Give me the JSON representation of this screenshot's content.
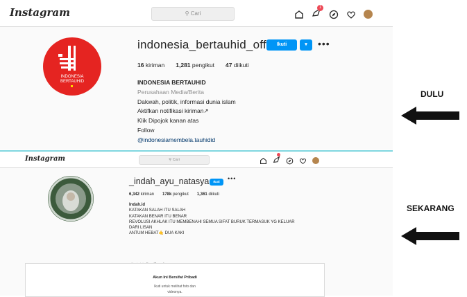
{
  "brand": "Instagram",
  "search_placeholder": "Cari",
  "labels": {
    "old": "DULU",
    "new": "SEKARANG"
  },
  "old_profile": {
    "username": "indonesia_bertauhid_official",
    "follow_label": "Ikuti",
    "stats": {
      "posts": "16",
      "posts_label": "kiriman",
      "followers": "1,281",
      "followers_label": "pengikut",
      "following": "47",
      "following_label": "diikuti"
    },
    "display_name": "INDONESIA BERTAUHID",
    "category": "Perusahaan Media/Berita",
    "bio_lines": [
      "Dakwah, politik, informasi dunia islam",
      "Aktifkan notifikasi kiriman↗",
      "Klik Dipojok kanan atas",
      "Follow"
    ],
    "link": "@indonesiamembela.tauhidid",
    "notification_count": "1"
  },
  "new_profile": {
    "username": "_indah_ayu_natasya",
    "follow_label": "Ikuti",
    "stats": {
      "posts": "6,342",
      "posts_label": "kiriman",
      "followers": "178k",
      "followers_label": "pengikut",
      "following": "1,361",
      "following_label": "diikuti"
    },
    "display_name": "Indah.id",
    "bio_lines": [
      "KATAKAN SALAH ITU SALAH",
      "KATAKAN BENAR ITU BENAR",
      "REVOLUSI AKHLAK ITU MEMBENAHI SEMUA SIFAT BURUK TERMASUK YG KELUAR",
      "DARI LISAN",
      "ANTUM HEBAT🤙 DUA KAKI"
    ],
    "followed_by_prefix": "Diikuti oleh",
    "followed_by_user": "riko_dilawati",
    "private_title": "Akun Ini Bersifat Pribadi",
    "private_sub_1": "Ikuti untuk melihat foto dan",
    "private_sub_2": "videonya."
  },
  "colors": {
    "follow_blue": "#0095f6",
    "avatar_red": "#e52421",
    "divider": "#7fd6df"
  }
}
